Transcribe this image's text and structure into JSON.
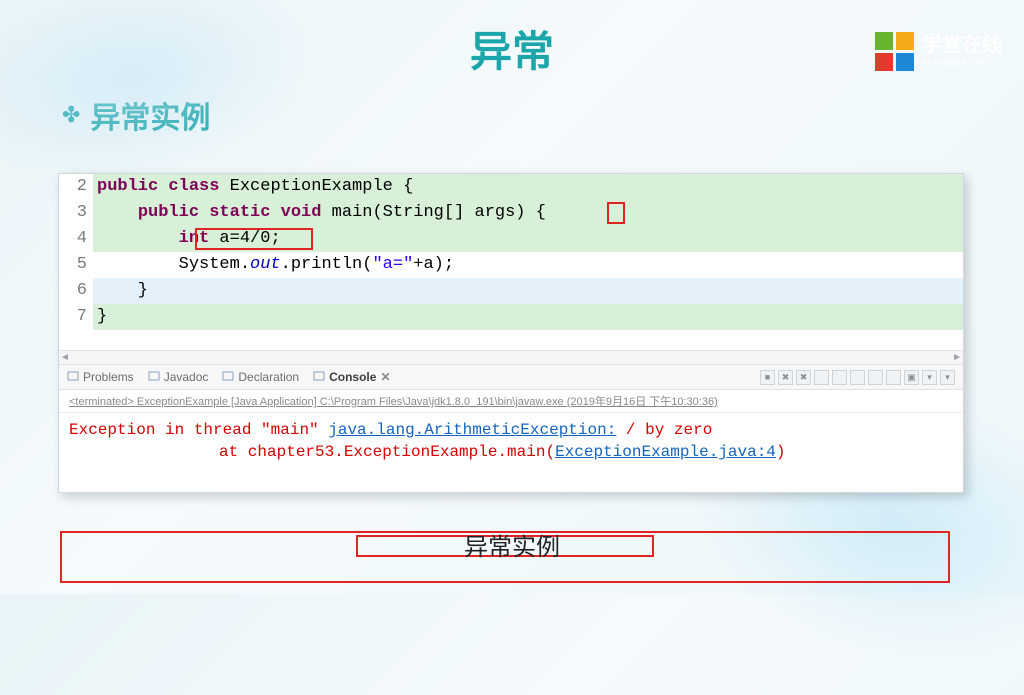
{
  "logo": {
    "cn": "学堂在线",
    "en": "xuetangx.com",
    "colors": [
      "#69b42d",
      "#f4a917",
      "#e23b2e",
      "#1e87d6"
    ]
  },
  "slide": {
    "title": "异常",
    "section": "异常实例",
    "caption": "异常实例"
  },
  "code": {
    "lines": [
      {
        "n": 2,
        "hl": "green",
        "tokens": [
          {
            "t": "public",
            "c": "kw"
          },
          {
            "t": " "
          },
          {
            "t": "class",
            "c": "kw"
          },
          {
            "t": " ExceptionExample {"
          }
        ]
      },
      {
        "n": 3,
        "hl": "green",
        "indent": "    ",
        "tokens": [
          {
            "t": "public",
            "c": "kw"
          },
          {
            "t": " "
          },
          {
            "t": "static",
            "c": "kw"
          },
          {
            "t": " "
          },
          {
            "t": "void",
            "c": "kw"
          },
          {
            "t": " main(String[] args) {"
          }
        ]
      },
      {
        "n": 4,
        "hl": "green",
        "indent": "        ",
        "tokens": [
          {
            "t": "int",
            "c": "kw"
          },
          {
            "t": " a=4/0;"
          }
        ]
      },
      {
        "n": 5,
        "hl": "none",
        "indent": "        ",
        "tokens": [
          {
            "t": "System."
          },
          {
            "t": "out",
            "c": "it"
          },
          {
            "t": ".println("
          },
          {
            "t": "\"a=\"",
            "c": "str"
          },
          {
            "t": "+a);"
          }
        ]
      },
      {
        "n": 6,
        "hl": "blue",
        "indent": "    ",
        "tokens": [
          {
            "t": "}"
          }
        ]
      },
      {
        "n": 7,
        "hl": "green",
        "tokens": [
          {
            "t": "}"
          }
        ]
      }
    ]
  },
  "tabs": {
    "items": [
      {
        "label": "Problems",
        "icon": "problems"
      },
      {
        "label": "Javadoc",
        "icon": "javadoc"
      },
      {
        "label": "Declaration",
        "icon": "decl"
      },
      {
        "label": "Console",
        "icon": "console",
        "active": true
      }
    ]
  },
  "status": "<terminated> ExceptionExample [Java Application] C:\\Program Files\\Java\\jdk1.8.0_191\\bin\\javaw.exe (2019年9月16日 下午10:30:36)",
  "console": {
    "line1_a": "Exception in thread \"main\" ",
    "line1_exc": "java.lang.ArithmeticException:",
    "line1_b": " / by zero",
    "line2_a": "at chapter53.ExceptionExample.main(",
    "line2_link": "ExceptionExample.java:4",
    "line2_b": ")"
  }
}
